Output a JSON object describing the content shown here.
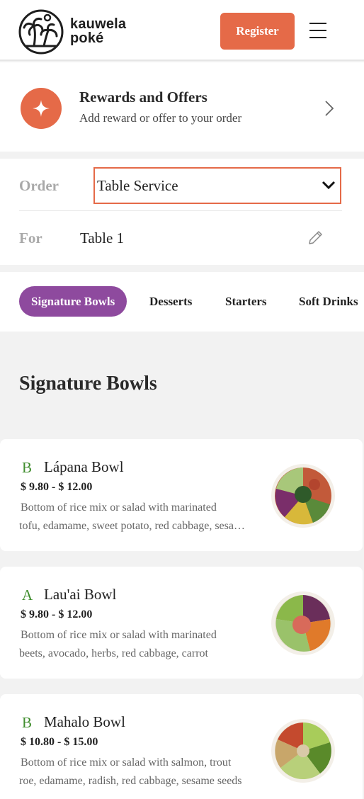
{
  "header": {
    "brand_line1": "kauwela",
    "brand_line2": "poké",
    "register_label": "Register",
    "menu_icon": "hamburger-icon",
    "logo_icon": "palm-tree-logo-icon"
  },
  "rewards": {
    "title": "Rewards and Offers",
    "subtitle": "Add reward or offer to your order",
    "icon": "sparkle-icon",
    "chevron_icon": "chevron-right-icon"
  },
  "order": {
    "order_label": "Order",
    "order_value": "Table Service",
    "for_label": "For",
    "for_value": "Table 1",
    "edit_icon": "pencil-icon"
  },
  "tabs": [
    {
      "label": "Signature Bowls",
      "active": true
    },
    {
      "label": "Desserts",
      "active": false
    },
    {
      "label": "Starters",
      "active": false
    },
    {
      "label": "Soft Drinks",
      "active": false
    }
  ],
  "section": {
    "title": "Signature Bowls"
  },
  "products": [
    {
      "grade": "B",
      "name": "Lápana Bowl",
      "price": "$ 9.80 - $ 12.00",
      "desc_line1": "Bottom of rice mix or salad with marinated",
      "desc_line2": "tofu, edamame, sweet potato, red cabbage, sesame seeds"
    },
    {
      "grade": "A",
      "name": "Lau'ai Bowl",
      "price": "$ 9.80 - $ 12.00",
      "desc_line1": "Bottom of rice mix or salad with marinated",
      "desc_line2": "beets, avocado, herbs, red cabbage, carrot"
    },
    {
      "grade": "B",
      "name": "Mahalo Bowl",
      "price": "$ 10.80 - $ 15.00",
      "desc_line1": "Bottom of rice mix or salad with salmon, trout",
      "desc_line2": "roe, edamame, radish, red cabbage, sesame seeds"
    }
  ],
  "colors": {
    "accent": "#e56a48",
    "tab_active": "#8e4a9e",
    "grade_green": "#3f8d2d"
  }
}
